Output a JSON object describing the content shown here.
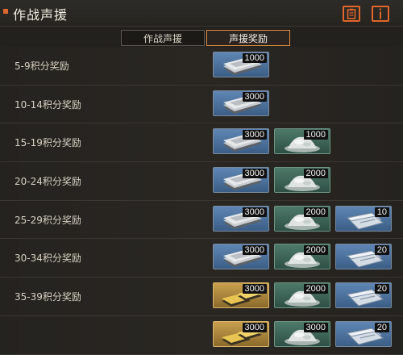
{
  "window": {
    "title": "作战声援"
  },
  "tabs": [
    {
      "label": "作战声援",
      "active": false
    },
    {
      "label": "声援奖励",
      "active": true
    }
  ],
  "rows": [
    {
      "label": "5-9积分奖励",
      "rewards": [
        {
          "type": "cash-stack",
          "qty": "1000"
        }
      ]
    },
    {
      "label": "10-14积分奖励",
      "rewards": [
        {
          "type": "cash-stack",
          "qty": "3000"
        }
      ]
    },
    {
      "label": "15-19积分奖励",
      "rewards": [
        {
          "type": "cash-stack",
          "qty": "3000"
        },
        {
          "type": "silver-pile",
          "qty": "1000"
        }
      ]
    },
    {
      "label": "20-24积分奖励",
      "rewards": [
        {
          "type": "cash-stack",
          "qty": "3000"
        },
        {
          "type": "silver-pile",
          "qty": "2000"
        }
      ]
    },
    {
      "label": "25-29积分奖励",
      "rewards": [
        {
          "type": "cash-stack",
          "qty": "3000"
        },
        {
          "type": "silver-pile",
          "qty": "2000"
        },
        {
          "type": "ticket",
          "qty": "10"
        }
      ]
    },
    {
      "label": "30-34积分奖励",
      "rewards": [
        {
          "type": "cash-stack",
          "qty": "3000"
        },
        {
          "type": "silver-pile",
          "qty": "2000"
        },
        {
          "type": "ticket",
          "qty": "20"
        }
      ]
    },
    {
      "label": "35-39积分奖励",
      "rewards": [
        {
          "type": "gold-bars",
          "qty": "3000"
        },
        {
          "type": "silver-pile",
          "qty": "2000"
        },
        {
          "type": "ticket",
          "qty": "20"
        }
      ]
    },
    {
      "label": "",
      "rewards": [
        {
          "type": "gold-bars",
          "qty": "3000"
        },
        {
          "type": "silver-pile",
          "qty": "3000"
        },
        {
          "type": "ticket",
          "qty": "20"
        }
      ]
    }
  ],
  "colors": {
    "accent": "#e0672c",
    "tab_active_border": "#e38a3c",
    "cash_bg": "#4d72a0",
    "silver_bg": "#3f6657",
    "gold_bg": "#b08a3e"
  }
}
